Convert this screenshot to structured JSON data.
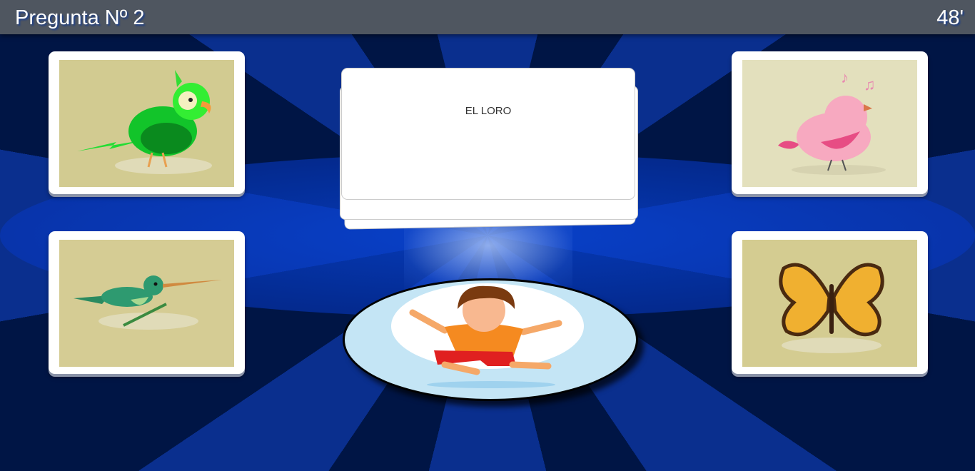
{
  "header": {
    "title": "Pregunta Nº 2",
    "timer": "48'"
  },
  "question": {
    "text": "EL LORO"
  },
  "options": [
    {
      "name": "parrot",
      "bg": "#d2cb91"
    },
    {
      "name": "pink-bird",
      "bg": "#e3e0bd"
    },
    {
      "name": "hummingbird",
      "bg": "#d5cc94"
    },
    {
      "name": "butterfly",
      "bg": "#d4cc91"
    }
  ]
}
